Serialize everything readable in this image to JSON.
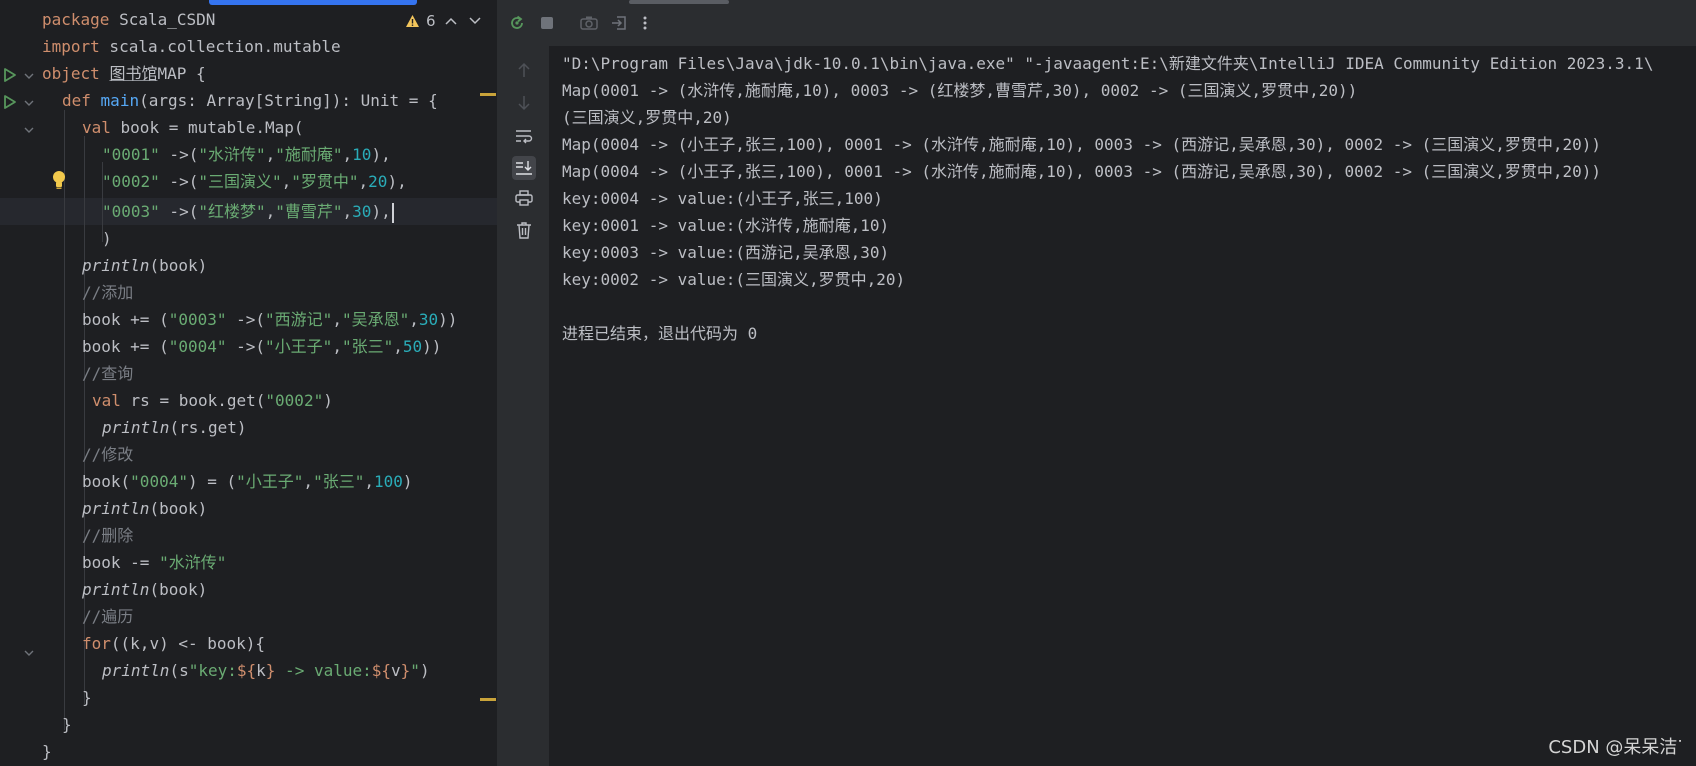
{
  "editor": {
    "warning_count": "6",
    "lines": {
      "l1_kw": "package",
      "l1_rest": " Scala_CSDN",
      "l2_kw": "import",
      "l2_rest": " scala.collection.mutable",
      "l3_kw": "object",
      "l3_name": "图书馆",
      "l3_rest": "MAP {",
      "l4_kw": "def",
      "l4_fn": "main",
      "l4_rest": "(args: Array[String]): Unit = {",
      "l5_kw": "val",
      "l5_rest": " book = mutable.Map(",
      "l6_s1": "\"0001\"",
      "l6_mid": " ->(",
      "l6_s2": "\"水浒传\"",
      "l6_c1": ",",
      "l6_s3": "\"施耐庵\"",
      "l6_c2": ",",
      "l6_n": "10",
      "l6_end": "),",
      "l7_s1": "\"0002\"",
      "l7_mid": " ->(",
      "l7_s2": "\"三国演义\"",
      "l7_c1": ",",
      "l7_s3": "\"罗贯中\"",
      "l7_c2": ",",
      "l7_n": "20",
      "l7_end": "),",
      "l8_s1": "\"0003\"",
      "l8_mid": " ->(",
      "l8_s2": "\"红楼梦\"",
      "l8_c1": ",",
      "l8_s3": "\"曹雪芹\"",
      "l8_c2": ",",
      "l8_n": "30",
      "l8_end": "),",
      "l9": ")",
      "l10_fn": "println",
      "l10_rest": "(book)",
      "l11_cmt": "//添加",
      "l12_a": "book += (",
      "l12_s1": "\"0003\"",
      "l12_mid": " ->(",
      "l12_s2": "\"西游记\"",
      "l12_c1": ",",
      "l12_s3": "\"吴承恩\"",
      "l12_c2": ",",
      "l12_n": "30",
      "l12_end": "))",
      "l13_a": "book += (",
      "l13_s1": "\"0004\"",
      "l13_mid": " ->(",
      "l13_s2": "\"小王子\"",
      "l13_c1": ",",
      "l13_s3": "\"张三\"",
      "l13_c2": ",",
      "l13_n": "50",
      "l13_end": "))",
      "l14_cmt": "//查询",
      "l15_kw": "val",
      "l15_a": " rs = book.get(",
      "l15_s": "\"0002\"",
      "l15_end": ")",
      "l16_fn": "println",
      "l16_rest": "(rs.get)",
      "l17_cmt": "//修改",
      "l18_a": "book(",
      "l18_s1": "\"0004\"",
      "l18_b": ") = (",
      "l18_s2": "\"小王子\"",
      "l18_c1": ",",
      "l18_s3": "\"张三\"",
      "l18_c2": ",",
      "l18_n": "100",
      "l18_end": ")",
      "l19_fn": "println",
      "l19_rest": "(book)",
      "l20_cmt": "//删除",
      "l21_a": "book -= ",
      "l21_s": "\"水浒传\"",
      "l22_fn": "println",
      "l22_rest": "(book)",
      "l23_cmt": "//遍历",
      "l24_kw": "for",
      "l24_rest": "((k,v) <- book){",
      "l25_fn": "println",
      "l25_a": "(s",
      "l25_s1": "\"key:",
      "l25_d1": "${",
      "l25_v1": "k",
      "l25_d2": "}",
      "l25_s2": " -> value:",
      "l25_d3": "${",
      "l25_v2": "v",
      "l25_d4": "}",
      "l25_s3": "\"",
      "l25_end": ")",
      "l26": "}",
      "l27": "}",
      "l28": "}"
    }
  },
  "console": {
    "lines": [
      "\"D:\\Program Files\\Java\\jdk-10.0.1\\bin\\java.exe\" \"-javaagent:E:\\新建文件夹\\IntelliJ IDEA Community Edition 2023.3.1\\",
      "Map(0001 -> (水浒传,施耐庵,10), 0003 -> (红楼梦,曹雪芹,30), 0002 -> (三国演义,罗贯中,20))",
      "(三国演义,罗贯中,20)",
      "Map(0004 -> (小王子,张三,100), 0001 -> (水浒传,施耐庵,10), 0003 -> (西游记,吴承恩,30), 0002 -> (三国演义,罗贯中,20))",
      "Map(0004 -> (小王子,张三,100), 0001 -> (水浒传,施耐庵,10), 0003 -> (西游记,吴承恩,30), 0002 -> (三国演义,罗贯中,20))",
      "key:0004 -> value:(小王子,张三,100)",
      "key:0001 -> value:(水浒传,施耐庵,10)",
      "key:0003 -> value:(西游记,吴承恩,30)",
      "key:0002 -> value:(三国演义,罗贯中,20)",
      "",
      "进程已结束，退出代码为 0"
    ]
  },
  "watermark": "CSDN @呆呆洁ᐝ"
}
